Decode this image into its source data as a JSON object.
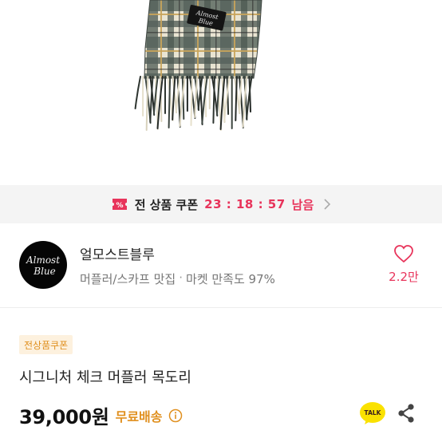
{
  "product_image": {
    "label_brand_line1": "Almost",
    "label_brand_line2": "Blue"
  },
  "coupon_banner": {
    "label": "전 상품 쿠폰",
    "timer": "23 : 18 : 57",
    "remain": "남음",
    "icon": "coupon-ticket-icon",
    "accent_color": "#e8345b"
  },
  "shop": {
    "logo_line1": "Almost",
    "logo_line2": "Blue",
    "name": "얼모스트블루",
    "category": "머플러/스카프 맛집",
    "separator": "·",
    "satisfaction": "마켓 만족도 97%",
    "like_count": "2.2만",
    "like_icon": "heart-outline-icon"
  },
  "product": {
    "badge": "전상품쿠폰",
    "title": "시그니처 체크 머플러 목도리",
    "price": "39,000원",
    "shipping": "무료배송",
    "shipping_color": "#e0901f",
    "info_icon": "info-circle-icon",
    "talk_label": "TALK",
    "share_icon": "share-icon"
  }
}
